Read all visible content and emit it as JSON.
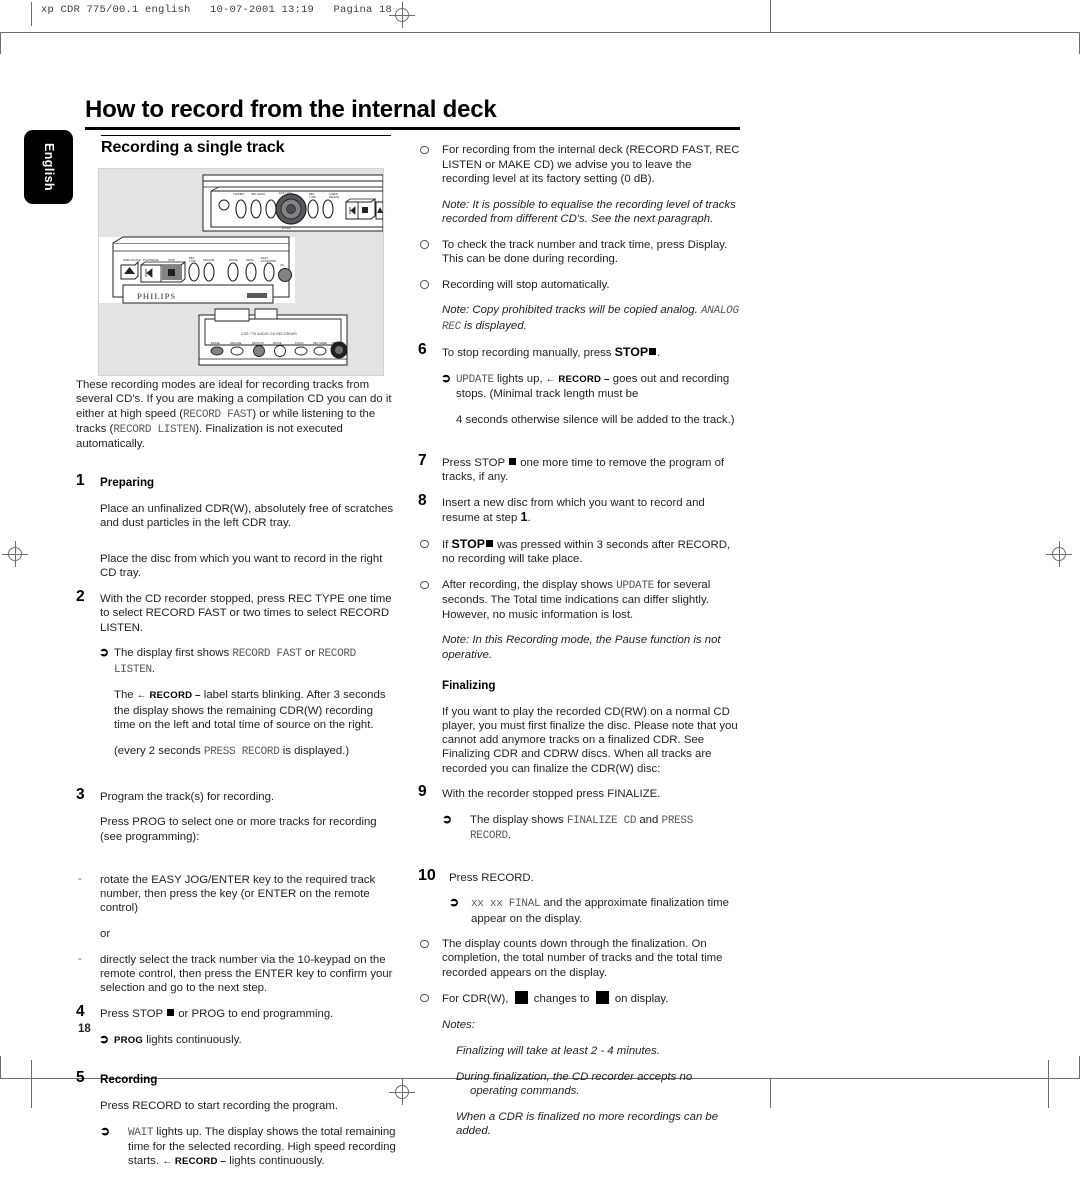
{
  "print_marks": {
    "slug": "xp CDR 775/00.1 english   10-07-2001 13:19   Pagina 18"
  },
  "language_tab": {
    "label": "English"
  },
  "header": {
    "chapter_title": "How to record from the internal deck",
    "section_title": "Recording a single track"
  },
  "illustration": {
    "name": "cd-recorder-front-panel-diagram",
    "brand_label": "PHILIPS",
    "device_label": "CDR 775 AUDIO CD RECORDER"
  },
  "left_column": {
    "intro": {
      "t1": "These recording modes are ideal for recording tracks from several CD's. If you are making a compilation CD you can do it either at high speed (",
      "lcd1": "RECORD FAST",
      "t2": ") or while listening to the tracks (",
      "lcd2": "RECORD LISTEN",
      "t3": "). Finalization is not executed automatically."
    },
    "preparing_heading": "Preparing",
    "step1": {
      "num": "1",
      "text": "Place an unfinalized CDR(W), absolutely free of scratches and dust particles in the left CDR tray."
    },
    "para_right_tray": "Place the disc from which you want to record in the right CD tray.",
    "step2": {
      "num": "2",
      "text": "With the CD recorder stopped, press REC TYPE one time to select RECORD FAST or two times to select RECORD LISTEN.",
      "arrow1_pre": "The display first shows ",
      "arrow1_lcd1": "RECORD FAST",
      "arrow1_mid": " or ",
      "arrow1_lcd2": "RECORD LISTEN",
      "arrow1_post": ".",
      "arrow1_b_pre": "The ",
      "arrow1_b_label": "← RECORD –",
      "arrow1_b_post": " label starts blinking. After 3 seconds the display shows the remaining CDR(W) recording time on the left and total time of source on the right.",
      "arrow1_c_pre": "(every 2 seconds ",
      "arrow1_c_lcd": "PRESS RECORD",
      "arrow1_c_post": " is displayed.)"
    },
    "step3": {
      "num": "3",
      "text": "Program the track(s) for recording.",
      "text2": "Press PROG to select one or more tracks for recording (see programming):"
    },
    "dash1": "rotate the EASY JOG/ENTER key to the required track number, then press the key (or ENTER on the remote control)",
    "or_label": "or",
    "dash2": "directly select the track number via the 10-keypad on the remote control, then press the ENTER key to confirm your selection and go to the next step.",
    "step4": {
      "num": "4",
      "text_pre": "Press STOP ",
      "text_post": " or PROG to end programming.",
      "arrow_label": "PROG",
      "arrow_text": " lights continuously."
    },
    "recording_heading": "Recording",
    "step5": {
      "num": "5",
      "text": "Press RECORD to start recording the program.",
      "arrow_lcd": "WAIT",
      "arrow_text": " lights up. The display shows the total remaining time for the selected recording. High speed recording starts. ",
      "arrow_label": "← RECORD –",
      "arrow_text2": " lights continuously."
    }
  },
  "right_column": {
    "bullet1": "For recording from the internal deck (RECORD FAST, REC LISTEN or MAKE CD) we advise you to leave the recording level at its factory setting (0 dB).",
    "note1": "Note: It is possible to equalise the recording level of tracks recorded from different CD's. See the next paragraph.",
    "bullet2": "To check the track number and track time, press Display. This can be done during recording.",
    "bullet3": "Recording will stop automatically.",
    "note2_pre": "Note: Copy prohibited tracks will be copied analog. ",
    "note2_lcd": "ANALOG REC",
    "note2_post": " is displayed.",
    "step6": {
      "num": "6",
      "text_pre": "To stop recording manually, press ",
      "text_bold": "STOP",
      "text_post": ".",
      "arrow_lcd": "UPDATE",
      "arrow_mid": " lights up, ",
      "arrow_label": "← RECORD –",
      "arrow_post": " goes out and recording stops. (Minimal track length must be",
      "arrow_post2": "4 seconds otherwise silence will be added to the track.)"
    },
    "step7": {
      "num": "7",
      "text_pre": "Press STOP ",
      "text_post": " one more time to remove the program of tracks, if any."
    },
    "step8": {
      "num": "8",
      "text_pre": "Insert a new disc from which you want to record and resume at step ",
      "text_bold": "1",
      "text_post": "."
    },
    "bullet4_pre": "If ",
    "bullet4_bold": "STOP",
    "bullet4_post": " was pressed within 3 seconds after RECORD, no recording will take place.",
    "bullet5_pre": "After recording, the display shows ",
    "bullet5_lcd": "UPDATE",
    "bullet5_post": " for several seconds. The Total time indications can differ slightly. However, no music information is lost.",
    "note3": "Note: In this Recording mode, the Pause function is not operative.",
    "finalizing_heading": "Finalizing",
    "finalizing_text": "If you want to play the recorded CD(RW) on a normal CD player, you must first finalize the disc. Please note that you cannot add anymore tracks on a finalized CDR. See Finalizing CDR and CDRW discs. When all tracks are recorded you can finalize the CDR(W) disc:",
    "step9": {
      "num": "9",
      "text": "With the recorder stopped press FINALIZE.",
      "arrow_pre": "The display shows ",
      "arrow_lcd1": "FINALIZE CD",
      "arrow_mid": " and ",
      "arrow_lcd2": "PRESS RECORD",
      "arrow_post": "."
    },
    "step10": {
      "num": "10",
      "text": "Press RECORD.",
      "arrow_lcd": "xx xx FINAL",
      "arrow_text": " and the approximate finalization time appear on the display."
    },
    "bullet6": "The display counts down through the finalization. On completion, the total number of tracks and the total time recorded appears on the display.",
    "bullet7_pre": "For CDR(W), ",
    "bullet7_mid": " changes to ",
    "bullet7_post": " on display.",
    "notes_heading": "Notes:",
    "note_a": "Finalizing will take at least 2 - 4 minutes.",
    "note_b": "During finalization, the CD recorder accepts no operating commands.",
    "note_c": "When a CDR is finalized no more recordings can be added."
  },
  "footer": {
    "page_number": "18"
  }
}
